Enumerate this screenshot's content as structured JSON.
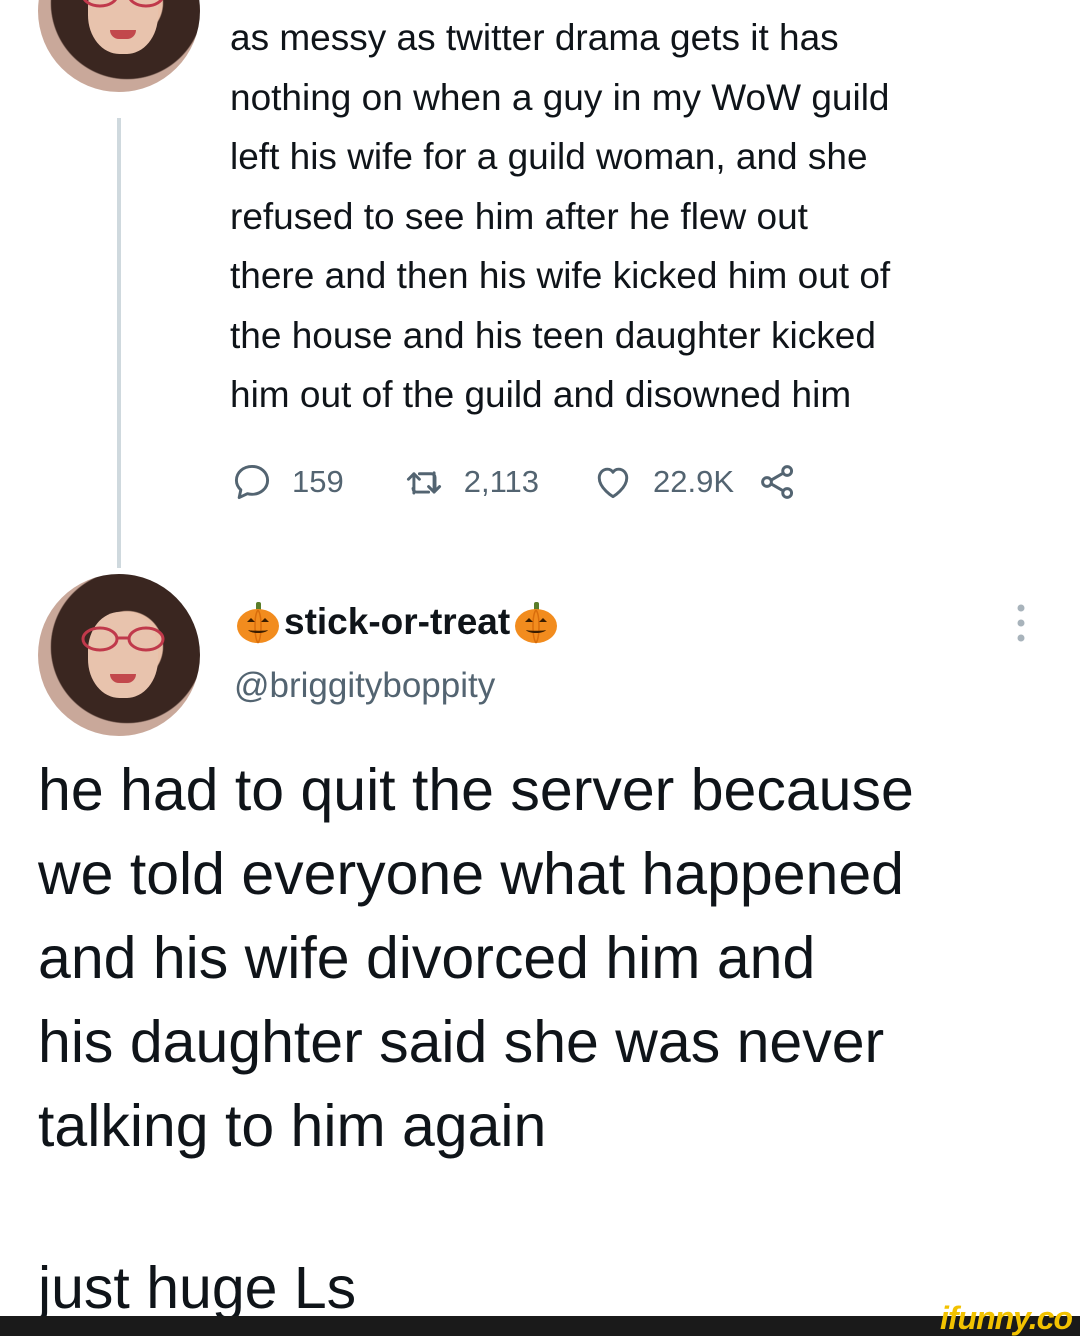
{
  "tweet": {
    "text": "as messy as twitter drama gets it has\nnothing on when a guy in my WoW guild\nleft his wife for a guild woman, and she\nrefused to see him after he flew out\nthere and then his wife kicked him out of\nthe house and his teen daughter kicked\nhim out of the guild and disowned him",
    "replies": "159",
    "retweets": "2,113",
    "likes": "22.9K",
    "icons": [
      "reply-icon",
      "retweet-icon",
      "like-icon",
      "share-icon"
    ]
  },
  "reply": {
    "display_name": "stick-or-treat",
    "handle": "@briggityboppity",
    "text": "he had to quit the server because\nwe told everyone what happened\nand his wife divorced him and\nhis daughter said she was never\ntalking to him again",
    "tail": "just huge Ls"
  },
  "watermark": "ifunny.co",
  "colors": {
    "text": "#0f1419",
    "secondary": "#536471",
    "thread_line": "#cfd9de",
    "pumpkin": "#f28c1e",
    "watermark": "#f2c200"
  }
}
